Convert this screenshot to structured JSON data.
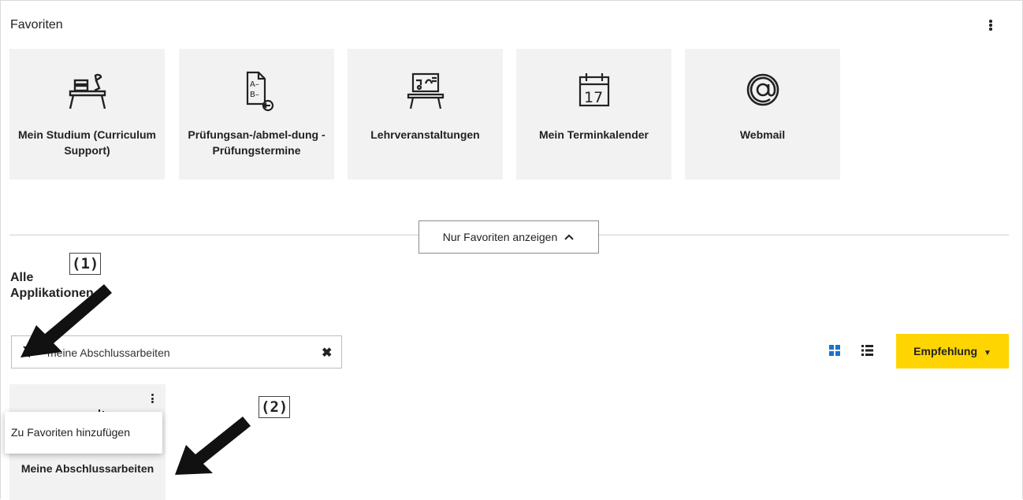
{
  "favorites": {
    "title": "Favoriten",
    "tiles": [
      {
        "label": "Mein Studium (Curriculum Support)",
        "icon": "desk-icon"
      },
      {
        "label": "Prüfungsan-/abmel-dung - Prüfungstermine",
        "icon": "exam-registration-icon"
      },
      {
        "label": "Lehrveranstaltungen",
        "icon": "lecture-board-icon"
      },
      {
        "label": "Mein Terminkalender",
        "icon": "calendar-icon",
        "calendar_day": "17"
      },
      {
        "label": "Webmail",
        "icon": "at-icon"
      }
    ],
    "toggle_label": "Nur Favoriten anzeigen"
  },
  "all_apps": {
    "title": "Alle Applikationen",
    "search_value": "meine Abschlussarbeiten",
    "sort_label": "Empfehlung",
    "app_tile_label": "Meine Abschlussarbeiten",
    "context_menu_item": "Zu Favoriten hinzufügen"
  },
  "annotations": {
    "marker1": "(1)",
    "marker2": "(2)"
  },
  "colors": {
    "accent_yellow": "#ffd500",
    "tile_bg": "#f2f2f2",
    "grid_view_blue": "#1a73c9"
  }
}
